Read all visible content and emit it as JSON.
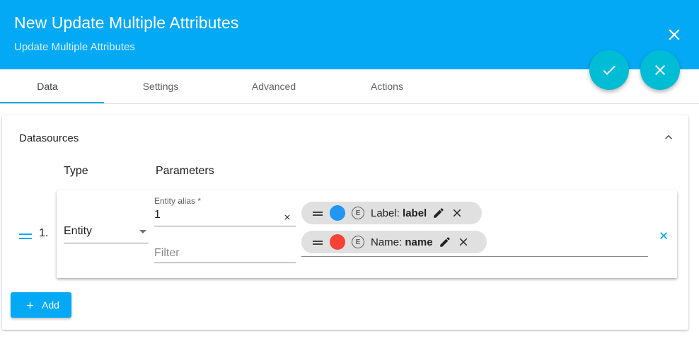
{
  "header": {
    "title": "New Update Multiple Attributes",
    "subtitle": "Update Multiple Attributes",
    "close_icon": "close-icon",
    "background": "#03a9f4"
  },
  "fabs": {
    "confirm_icon": "check-icon",
    "cancel_icon": "close-icon",
    "color": "#00bcd4"
  },
  "tabs": [
    {
      "label": "Data",
      "active": true
    },
    {
      "label": "Settings",
      "active": false
    },
    {
      "label": "Advanced",
      "active": false
    },
    {
      "label": "Actions",
      "active": false
    }
  ],
  "datasources": {
    "title": "Datasources",
    "collapse_icon": "chevron-up-icon",
    "columns": {
      "type": "Type",
      "parameters": "Parameters"
    },
    "rows": [
      {
        "index": "1.",
        "type": "Entity",
        "alias_label": "Entity alias *",
        "alias_value": "1",
        "filter_placeholder": "Filter",
        "keys": [
          {
            "prefix": "Label: ",
            "name": "label",
            "color": "#2196f3",
            "badge": "E"
          },
          {
            "prefix": "Name: ",
            "name": "name",
            "color": "#f44336",
            "badge": "E"
          }
        ]
      }
    ],
    "add_label": "Add"
  }
}
